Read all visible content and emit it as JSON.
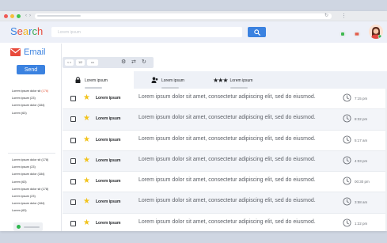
{
  "browser": {
    "traffic_lights": [
      "#f05a55",
      "#f6bf3a",
      "#41c54f"
    ],
    "nav_back": "‹",
    "nav_forward": "›",
    "reload": "↻",
    "more": "⋮"
  },
  "header": {
    "logo_letters": [
      {
        "ch": "S",
        "color": "#3b82e0"
      },
      {
        "ch": "e",
        "color": "#e84a3b"
      },
      {
        "ch": "a",
        "color": "#f3b51d"
      },
      {
        "ch": "r",
        "color": "#3b82e0"
      },
      {
        "ch": "c",
        "color": "#38a84f"
      },
      {
        "ch": "h",
        "color": "#e84a3b"
      }
    ],
    "search_placeholder": "Lorem ipsum",
    "icon_colors": [
      "#3fb950",
      "#e35d4a",
      "#3b82e0"
    ]
  },
  "sidebar": {
    "logo_label": "Email",
    "compose_label": "Send",
    "folders_primary": [
      {
        "label": "Lorem ipsum dolor sit ",
        "count": "(176)",
        "highlight": true
      },
      {
        "label": "Lorem ipsum ",
        "count": "(23)",
        "highlight": false
      },
      {
        "label": "Lorem ipsum dolor ",
        "count": "(184)",
        "highlight": false
      },
      {
        "label": "Lorem ",
        "count": "(63)",
        "highlight": false
      }
    ],
    "folders_secondary": [
      "Lorem ipsum dolor sit (178)",
      "Lorem ipsum (23)",
      "Lorem ipsum dolor (184)",
      "Lorem (63)",
      "Lorem ipsum dolor sit (178)",
      "Lorem ipsum (23)",
      "Lorem ipsum dolor (184)",
      "Lorem (63)"
    ]
  },
  "toolbar": {
    "buttons": [
      "< >",
      "1/2",
      "•••"
    ],
    "icons": [
      "gear-icon",
      "swap-icon",
      "refresh-icon"
    ]
  },
  "tabs": [
    {
      "label": "Lorem ipsum",
      "icon": "lock-icon",
      "active": true
    },
    {
      "label": "Lorem ipsum",
      "icon": "users-icon",
      "active": false
    },
    {
      "label": "Lorem ipsum",
      "icon": "stars-icon",
      "active": false
    }
  ],
  "messages": [
    {
      "sender": "Lorem ipsum",
      "preview": "Lorem ipsum dolor sit amet, consectetur adipiscing elit, sed do eiusmod.",
      "time": "7:15 pm",
      "starred": true
    },
    {
      "sender": "Lorem ipsum",
      "preview": "Lorem ipsum dolor sit amet, consectetur adipiscing elit, sed do eiusmod.",
      "time": "8:32 pm",
      "starred": true
    },
    {
      "sender": "Lorem ipsum",
      "preview": "Lorem ipsum dolor sit amet, consectetur adipiscing elit, sed do eiusmod.",
      "time": "5:17 am",
      "starred": true
    },
    {
      "sender": "Lorem ipsum",
      "preview": "Lorem ipsum dolor sit amet, consectetur adipiscing elit, sed do eiusmod.",
      "time": "4:03 pm",
      "starred": true
    },
    {
      "sender": "Lorem ipsum",
      "preview": "Lorem ipsum dolor sit amet, consectetur adipiscing elit, sed do eiusmod.",
      "time": "00:30 pm",
      "starred": true
    },
    {
      "sender": "Lorem ipsum",
      "preview": "Lorem ipsum dolor sit amet, consectetur adipiscing elit, sed do eiusmod.",
      "time": "3:58 am",
      "starred": true
    },
    {
      "sender": "Lorem ipsum",
      "preview": "Lorem ipsum dolor sit amet, consectetur adipiscing elit, sed do eiusmod.",
      "time": "1:22 pm",
      "starred": true
    }
  ],
  "colors": {
    "accent": "#3b82e0",
    "star": "#f2c31b",
    "online": "#2fb84f",
    "mail_icon": "#e84a3b"
  }
}
